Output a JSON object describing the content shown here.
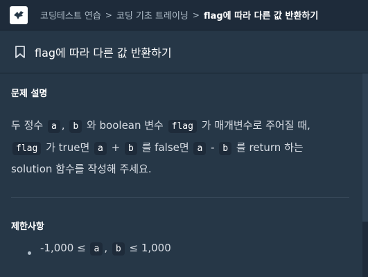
{
  "breadcrumb": {
    "items": [
      "코딩테스트 연습",
      "코딩 기초 트레이닝",
      "flag에 따라 다른 값 반환하기"
    ],
    "separator": ">"
  },
  "problem": {
    "title": "flag에 따라 다른 값 반환하기"
  },
  "description": {
    "heading": "문제 설명",
    "line1": {
      "t1": "두 정수",
      "c1": "a",
      "t2": ",",
      "c2": "b",
      "t3": "와 boolean 변수",
      "c3": "flag",
      "t4": "가 매개변수로 주어질 때,"
    },
    "line2": {
      "c1": "flag",
      "t1": "가 true면",
      "c2": "a",
      "t2": "+",
      "c3": "b",
      "t3": "를 false면",
      "c4": "a",
      "t4": "-",
      "c5": "b",
      "t5": "를 return 하는"
    },
    "line3": "solution 함수를 작성해 주세요."
  },
  "constraints": {
    "heading": "제한사항",
    "item1": {
      "t1": "-1,000 ≤",
      "c1": "a",
      "t2": ",",
      "c2": "b",
      "t3": "≤ 1,000"
    }
  },
  "icons": {
    "logo": "programmers-bird-logo",
    "bookmark": "bookmark-icon",
    "separator": "chevron-right-icon"
  },
  "colors": {
    "background": "#263747",
    "topbar": "#1e2b3a",
    "code_bg": "#1e2b3a"
  }
}
